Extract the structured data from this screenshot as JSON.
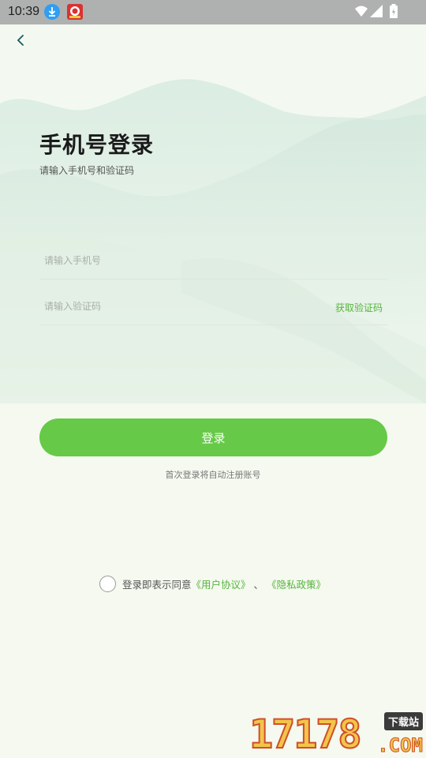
{
  "status_bar": {
    "time": "10:39",
    "icons": [
      "download-notification-icon",
      "app-notification-icon",
      "wifi-icon",
      "signal-icon",
      "battery-icon"
    ]
  },
  "header": {
    "back_icon": "chevron-left-icon"
  },
  "login": {
    "title": "手机号登录",
    "subtitle": "请输入手机号和验证码",
    "phone_placeholder": "请输入手机号",
    "code_placeholder": "请输入验证码",
    "get_code_label": "获取验证码",
    "button_label": "登录",
    "hint": "首次登录将自动注册账号"
  },
  "agreement": {
    "prefix": "登录即表示同意",
    "user_agreement": "《用户协议》",
    "separator": "、",
    "privacy_policy": "《隐私政策》",
    "checked": false
  },
  "watermark": {
    "number": "17178",
    "top_text": "下载站",
    "domain": ".COM"
  },
  "colors": {
    "accent": "#66c947",
    "link": "#56b43f",
    "background": "#f6faf2",
    "status_bar": "#aeb1af"
  }
}
